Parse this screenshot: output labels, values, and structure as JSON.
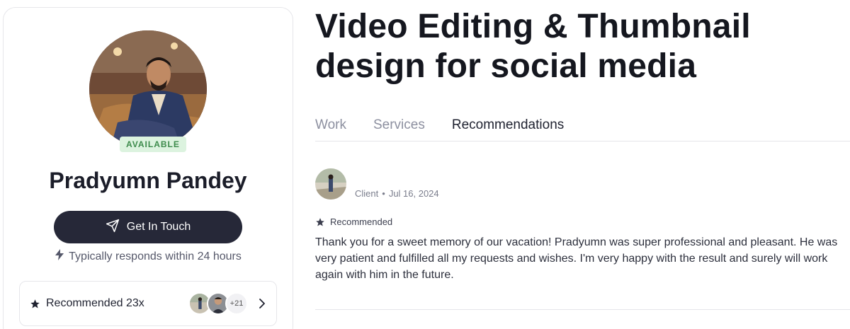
{
  "profile": {
    "name": "Pradyumn Pandey",
    "availability_badge": "AVAILABLE",
    "cta_label": "Get In Touch",
    "response_time": "Typically responds within 24 hours",
    "recommendations_summary": "Recommended 23x",
    "extra_recommenders": "+21"
  },
  "project": {
    "title": "Video Editing & Thumbnail design for social media"
  },
  "tabs": [
    {
      "label": "Work",
      "active": false
    },
    {
      "label": "Services",
      "active": false
    },
    {
      "label": "Recommendations",
      "active": true
    }
  ],
  "review": {
    "role": "Client",
    "separator": "•",
    "date": "Jul 16, 2024",
    "tag": "Recommended",
    "text": "Thank you for a sweet memory of our vacation! Pradyumn was super professional and pleasant. He was very patient and fulfilled all my requests and wishes. I'm very happy with the result and surely will work again with him in the future."
  },
  "icons": {
    "cta": "paper-plane-icon",
    "response": "lightning-icon",
    "star": "star-icon",
    "chevron": "chevron-right-icon"
  },
  "colors": {
    "button_bg": "#262838",
    "badge_bg": "#dcf3df",
    "badge_text": "#3d8b4c",
    "muted_tab": "#8d90a0"
  }
}
